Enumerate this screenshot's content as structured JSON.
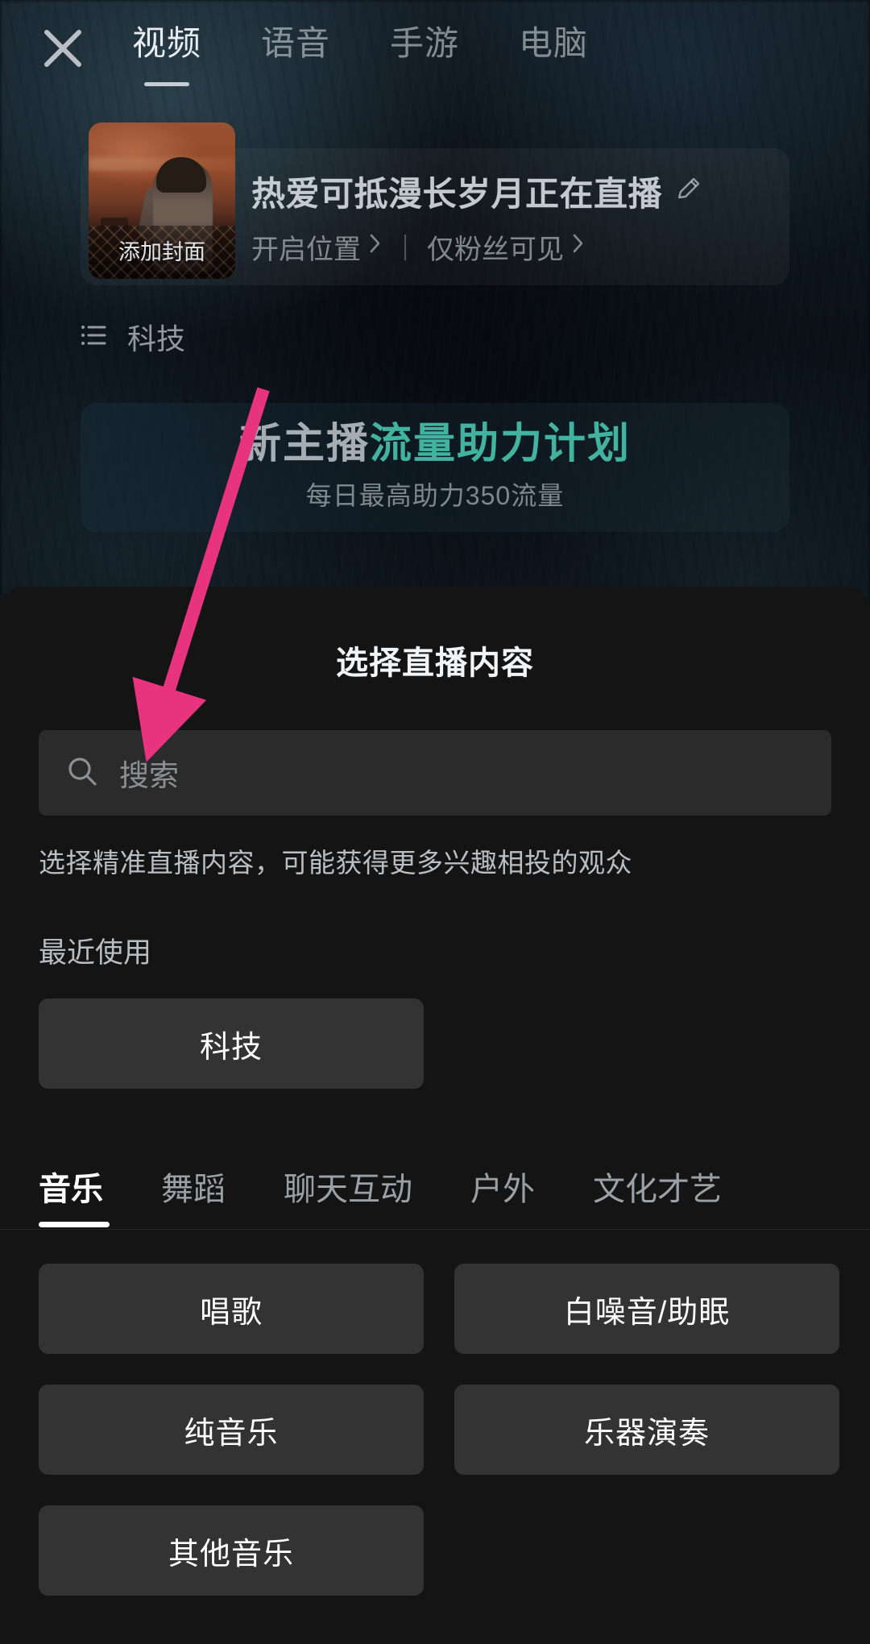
{
  "topbar": {
    "close_icon": "close-icon",
    "tabs": [
      {
        "label": "视频",
        "active": true
      },
      {
        "label": "语音",
        "active": false
      },
      {
        "label": "手游",
        "active": false
      },
      {
        "label": "电脑",
        "active": false
      }
    ]
  },
  "info_card": {
    "cover_label": "添加封面",
    "room_title": "热爱可抵漫长岁月正在直播",
    "edit_icon": "pencil-icon",
    "meta": [
      {
        "label": "开启位置",
        "icon": "chevron-right-icon"
      },
      {
        "label": "仅粉丝可见",
        "icon": "chevron-right-icon"
      }
    ]
  },
  "category_row": {
    "icon": "list-icon",
    "label": "科技"
  },
  "promo": {
    "title_plain": "新主播",
    "title_accent": "流量助力计划",
    "subtitle": "每日最高助力350流量",
    "accent_color": "#4ac8b2"
  },
  "sheet": {
    "title": "选择直播内容",
    "search": {
      "icon": "search-icon",
      "placeholder": "搜索",
      "value": ""
    },
    "hint": "选择精准直播内容，可能获得更多兴趣相投的观众",
    "recent": {
      "title": "最近使用",
      "items": [
        "科技"
      ]
    },
    "tabs": [
      {
        "label": "音乐",
        "active": true
      },
      {
        "label": "舞蹈",
        "active": false
      },
      {
        "label": "聊天互动",
        "active": false
      },
      {
        "label": "户外",
        "active": false
      },
      {
        "label": "文化才艺",
        "active": false
      }
    ],
    "items": [
      "唱歌",
      "白噪音/助眠",
      "纯音乐",
      "乐器演奏",
      "其他音乐"
    ]
  },
  "annotation": {
    "arrow_color": "#e8337f",
    "name": "arrow-pointing-to-search"
  }
}
